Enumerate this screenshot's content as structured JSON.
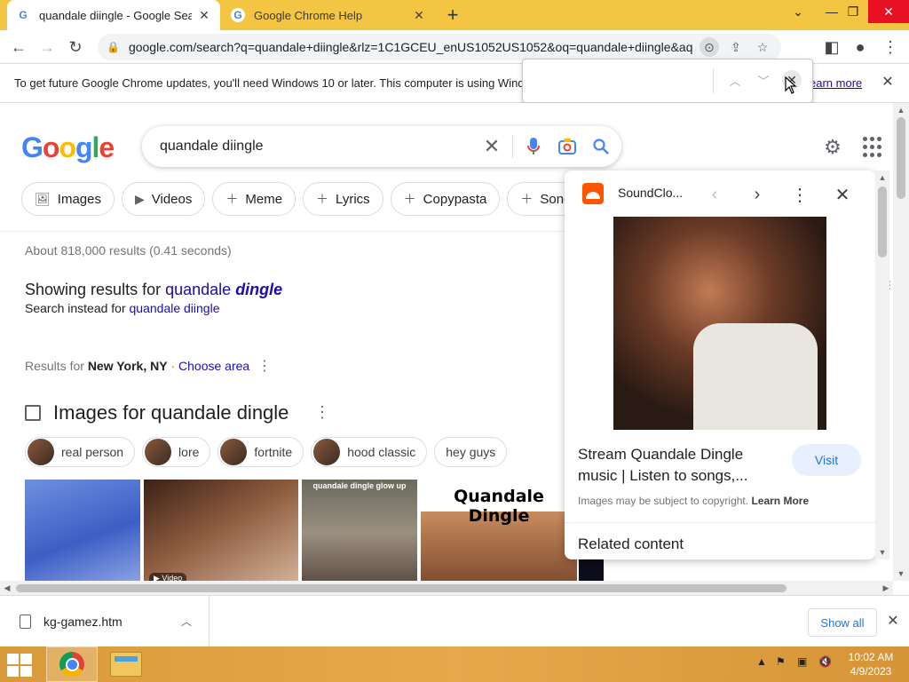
{
  "browser": {
    "tabs": [
      {
        "title": "quandale diingle - Google Search",
        "favicon": "G",
        "active": true
      },
      {
        "title": "Google Chrome Help",
        "favicon": "G",
        "active": false
      }
    ],
    "new_tab_label": "+",
    "url": "google.com/search?q=quandale+diingle&rlz=1C1GCEU_enUS1052US1052&oq=quandale+diingle&aqs=c...",
    "infobar": {
      "message": "To get future Google Chrome updates, you'll need Windows 10 or later. This computer is using Wind",
      "learn_more": "earn more"
    }
  },
  "google": {
    "logo": "Google",
    "query": "quandale diingle",
    "chips": [
      {
        "icon": "image-icon",
        "label": "Images"
      },
      {
        "icon": "video-icon",
        "label": "Videos"
      },
      {
        "icon": "plus-icon",
        "label": "Meme"
      },
      {
        "icon": "plus-icon",
        "label": "Lyrics"
      },
      {
        "icon": "plus-icon",
        "label": "Copypasta"
      },
      {
        "icon": "plus-icon",
        "label": "Song"
      }
    ],
    "stats": "About 818,000 results (0.41 seconds)",
    "showing_prefix": "Showing results for",
    "showing_word1": "quandale",
    "showing_word2": "dingle",
    "instead_prefix": "Search instead for",
    "instead_link": "quandale diingle",
    "location_prefix": "Results for",
    "location_city": "New York, NY",
    "location_sep": "·",
    "location_choose": "Choose area",
    "images_heading": "Images for quandale dingle",
    "refine_chips": [
      {
        "label": "real person",
        "has_thumb": true
      },
      {
        "label": "lore",
        "has_thumb": true
      },
      {
        "label": "fortnite",
        "has_thumb": true
      },
      {
        "label": "hood classic",
        "has_thumb": true
      },
      {
        "label": "hey guys",
        "has_thumb": false
      }
    ],
    "image_captions": {
      "img2_badge": "Video",
      "img3_caption": "quandale dingle glow up",
      "img4_caption": "Quandale Dingle"
    }
  },
  "side_panel": {
    "source": "SoundClo...",
    "title": "Stream Quandale Dingle music | Listen to songs,...",
    "visit_label": "Visit",
    "copyright_text": "Images may be subject to copyright.",
    "learn_more": "Learn More",
    "related": "Related content"
  },
  "download_bar": {
    "filename": "kg-gamez.htm",
    "show_all": "Show all"
  },
  "taskbar": {
    "time": "10:02 AM",
    "date": "4/9/2023"
  },
  "colors": {
    "tabstrip": "#f4c542",
    "link": "#1a0dab",
    "accent": "#1a73e8"
  }
}
